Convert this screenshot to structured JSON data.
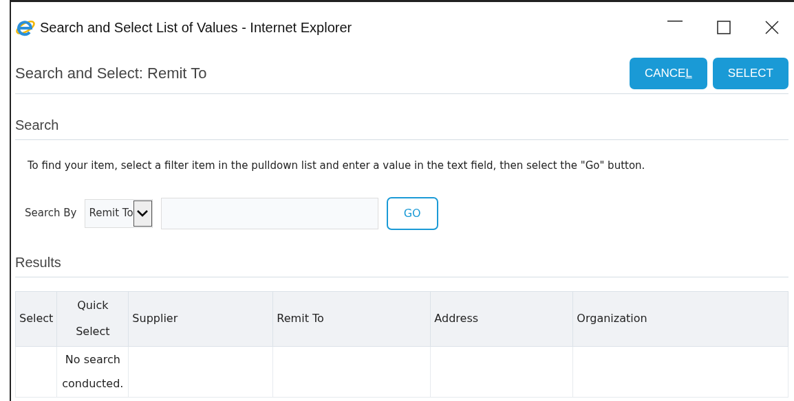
{
  "window": {
    "title": "Search and Select List of Values - Internet Explorer"
  },
  "dialog": {
    "title": "Search and Select: Remit To",
    "buttons": [
      {
        "label": "CANCE",
        "access_key": "L"
      },
      {
        "label": "SELECT"
      }
    ]
  },
  "search": {
    "heading": "Search",
    "instructions": "To find your item, select a filter item in the pulldown list and enter a value in the text field, then select the \"Go\" button.",
    "label": "Search By",
    "filter": "Remit To",
    "go": "GO"
  },
  "results": {
    "heading": "Results",
    "columns": [
      "Select",
      "Quick Select",
      "Supplier",
      "Remit To",
      "Address",
      "Organization"
    ],
    "rows": [
      [
        "",
        "No search conducted.",
        "",
        "",
        "",
        ""
      ]
    ]
  }
}
